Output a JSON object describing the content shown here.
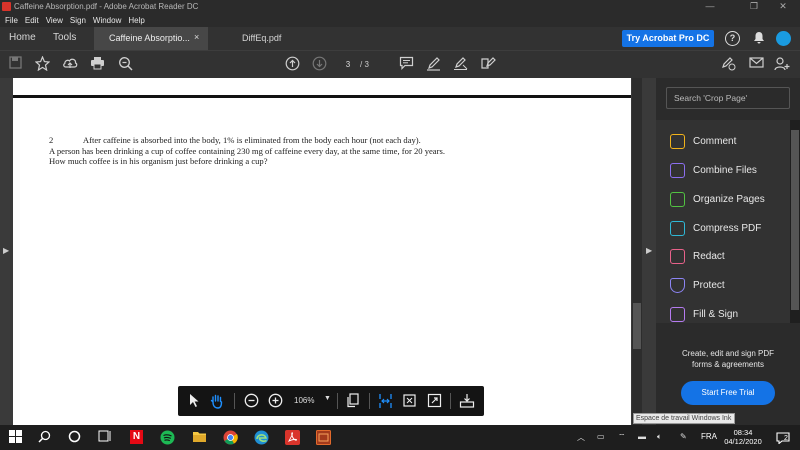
{
  "window": {
    "title": "Caffeine Absorption.pdf - Adobe Acrobat Reader DC",
    "minimize": "—",
    "restore": "❐",
    "close": "✕"
  },
  "menu": [
    "File",
    "Edit",
    "View",
    "Sign",
    "Window",
    "Help"
  ],
  "tabs": {
    "home": "Home",
    "tools": "Tools",
    "active_doc": "Caffeine Absorptio...",
    "active_close": "×",
    "other_doc": "DiffEq.pdf"
  },
  "header": {
    "try_button": "Try Acrobat Pro DC",
    "help": "?"
  },
  "toolbar": {
    "page_current": "3",
    "page_total": "/ 3"
  },
  "document": {
    "line1": "2              After caffeine is absorbed into the body, 1% is eliminated from the body each hour (not each day).",
    "line2": "A person has been drinking a cup of coffee containing 230 mg of caffeine every day, at the same time, for 20 years.",
    "line3": "How much coffee is in his organism just before drinking a cup?"
  },
  "zoom": {
    "value": "106%"
  },
  "right_panel": {
    "search_placeholder": "Search 'Crop Page'",
    "tools": [
      {
        "label": "Comment",
        "color": "#f2b31b"
      },
      {
        "label": "Combine Files",
        "color": "#8c6ff0"
      },
      {
        "label": "Organize Pages",
        "color": "#52c242"
      },
      {
        "label": "Compress PDF",
        "color": "#2fb8d6"
      },
      {
        "label": "Redact",
        "color": "#e8628a"
      },
      {
        "label": "Protect",
        "color": "#8d85f5"
      },
      {
        "label": "Fill & Sign",
        "color": "#b57bf0"
      }
    ],
    "promo_line1": "Create, edit and sign PDF",
    "promo_line2": "forms & agreements",
    "free_trial": "Start Free Trial"
  },
  "tooltip": "Espace de travail Windows Ink",
  "taskbar": {
    "language": "FRA",
    "time": "08:34",
    "date": "04/12/2020",
    "notifications": "2"
  },
  "colors": {
    "accent": "#1473e6",
    "acrobat_red": "#d9342b"
  }
}
